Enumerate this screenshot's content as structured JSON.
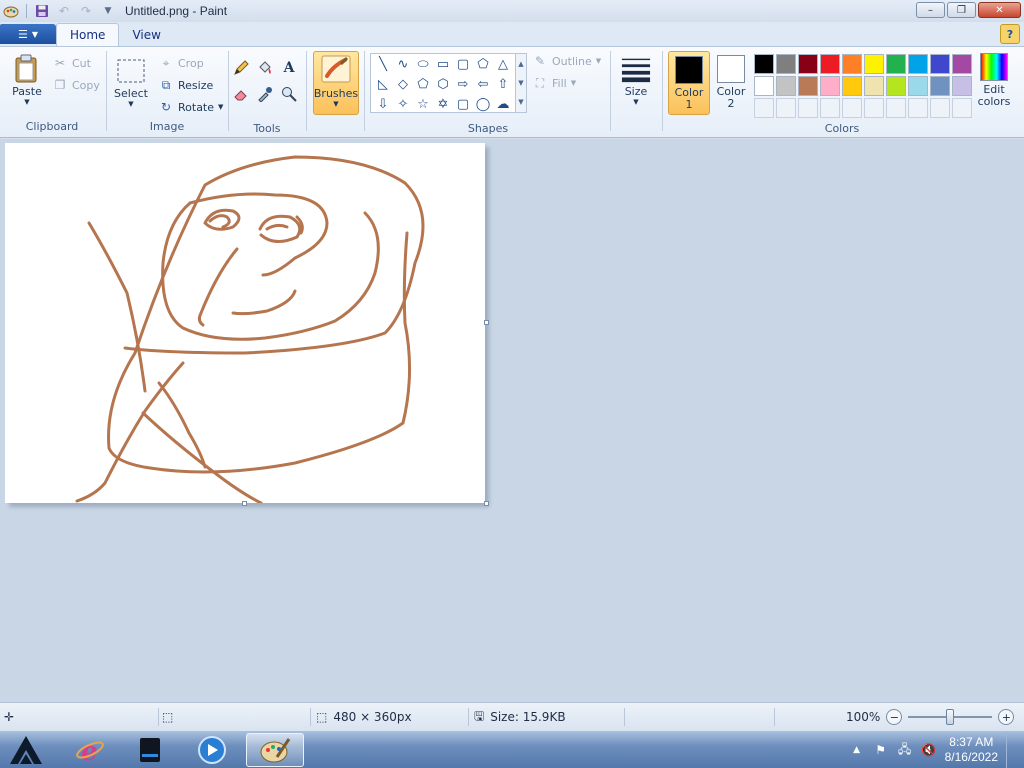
{
  "window": {
    "title": "Untitled.png - Paint"
  },
  "tabs": [
    {
      "label": "Home",
      "active": true
    },
    {
      "label": "View",
      "active": false
    }
  ],
  "clipboard": {
    "paste": "Paste",
    "cut": "Cut",
    "copy": "Copy",
    "group_label": "Clipboard"
  },
  "image": {
    "select": "Select",
    "crop": "Crop",
    "resize": "Resize",
    "rotate": "Rotate",
    "group_label": "Image"
  },
  "tools": {
    "group_label": "Tools",
    "items": [
      "pencil-icon",
      "fill-bucket-icon",
      "text-icon",
      "eraser-icon",
      "color-picker-icon",
      "magnifier-icon"
    ]
  },
  "brushes": {
    "label": "Brushes"
  },
  "shapes": {
    "outline": "Outline",
    "fill": "Fill",
    "group_label": "Shapes",
    "items": [
      "line",
      "curve",
      "oval",
      "rectangle",
      "rounded-rectangle",
      "polygon",
      "triangle",
      "right-triangle",
      "diamond",
      "pentagon",
      "hexagon",
      "right-arrow",
      "left-arrow",
      "up-arrow",
      "down-arrow",
      "four-point-star",
      "five-point-star",
      "six-point-star",
      "rounded-callout",
      "oval-callout",
      "cloud-callout"
    ]
  },
  "size": {
    "label": "Size"
  },
  "colors": {
    "color1_label": "Color",
    "color1_num": "1",
    "color2_label": "Color",
    "color2_num": "2",
    "color1": "#000000",
    "color2": "#ffffff",
    "group_label": "Colors",
    "edit": "Edit colors",
    "palette_row1": [
      "#000000",
      "#7f7f7f",
      "#880015",
      "#ed1c24",
      "#ff7f27",
      "#fff200",
      "#22b14c",
      "#00a2e8",
      "#3f48cc",
      "#a349a4"
    ],
    "palette_row2": [
      "#ffffff",
      "#c3c3c3",
      "#b97a57",
      "#ffaec9",
      "#ffc90e",
      "#efe4b0",
      "#b5e61d",
      "#99d9ea",
      "#7092be",
      "#c8bfe7"
    ]
  },
  "drawing": {
    "stroke_color": "#b5754e"
  },
  "status": {
    "dimensions": "480 × 360px",
    "size": "Size: 15.9KB",
    "zoom": "100%"
  },
  "taskbar": {
    "time": "8:37 AM",
    "date": "8/16/2022"
  }
}
